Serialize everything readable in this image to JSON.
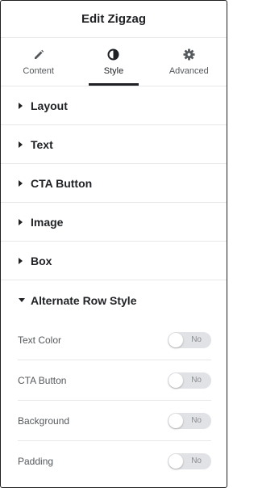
{
  "header": {
    "title": "Edit Zigzag"
  },
  "tabs": [
    {
      "label": "Content",
      "icon": "pencil-icon",
      "active": false
    },
    {
      "label": "Style",
      "icon": "half-circle-icon",
      "active": true
    },
    {
      "label": "Advanced",
      "icon": "gear-icon",
      "active": false
    }
  ],
  "sections": [
    {
      "label": "Layout",
      "expanded": false
    },
    {
      "label": "Text",
      "expanded": false
    },
    {
      "label": "CTA Button",
      "expanded": false
    },
    {
      "label": "Image",
      "expanded": false
    },
    {
      "label": "Box",
      "expanded": false
    },
    {
      "label": "Alternate Row Style",
      "expanded": true
    }
  ],
  "alternate_row_style": {
    "controls": [
      {
        "label": "Text Color",
        "toggle_text": "No",
        "on": false
      },
      {
        "label": "CTA Button",
        "toggle_text": "No",
        "on": false
      },
      {
        "label": "Background",
        "toggle_text": "No",
        "on": false
      },
      {
        "label": "Padding",
        "toggle_text": "No",
        "on": false
      }
    ]
  },
  "colors": {
    "text_dark": "#1f2124",
    "text_muted": "#55595c",
    "divider": "#e6e8ea",
    "switch_off": "#e0e2e5"
  }
}
